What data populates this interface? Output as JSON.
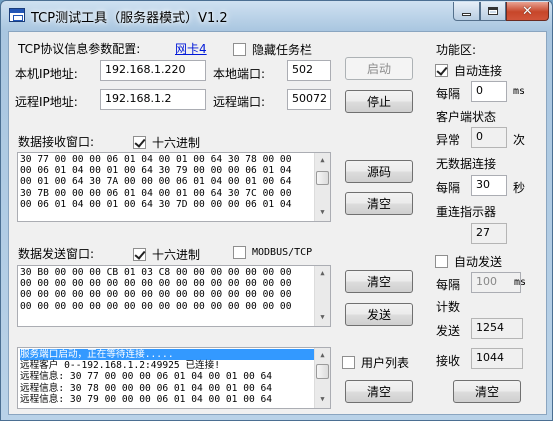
{
  "window": {
    "title": "TCP测试工具（服务器模式）V1.2"
  },
  "params": {
    "header": "TCP协议信息参数配置:",
    "nic_link": "网卡4",
    "hide_taskbar_label": "隐藏任务栏",
    "hide_taskbar_checked": false,
    "local_ip_label": "本机IP地址:",
    "local_ip": "192.168.1.220",
    "local_port_label": "本地端口:",
    "local_port": "502",
    "remote_ip_label": "远程IP地址:",
    "remote_ip": "192.168.1.2",
    "remote_port_label": "远程端口:",
    "remote_port": "50072",
    "start_label": "启动",
    "stop_label": "停止"
  },
  "receive": {
    "header": "数据接收窗口:",
    "hex_label": "十六进制",
    "hex_checked": true,
    "lines": [
      "30 77 00 00 00 06 01 04 00 01 00 64 30 78 00 00",
      "00 06 01 04 00 01 00 64 30 79 00 00 00 06 01 04",
      "00 01 00 64 30 7A 00 00 00 06 01 04 00 01 00 64",
      "30 7B 00 00 00 06 01 04 00 01 00 64 30 7C 00 00",
      "00 06 01 04 00 01 00 64 30 7D 00 00 00 06 01 04"
    ],
    "source_label": "源码",
    "clear_label": "清空"
  },
  "send": {
    "header": "数据发送窗口:",
    "hex_label": "十六进制",
    "hex_checked": true,
    "modbus_label": "MODBUS/TCP",
    "modbus_checked": false,
    "lines": [
      "30 B0 00 00 00 CB 01 03 C8 00 00 00 00 00 00 00",
      "00 00 00 00 00 00 00 00 00 00 00 00 00 00 00 00",
      "00 00 00 00 00 00 00 00 00 00 00 00 00 00 00 00",
      "00 00 00 00 00 00 00 00 00 00 00 00 00 00 00 00"
    ],
    "clear_label": "清空",
    "send_label": "发送"
  },
  "log": {
    "lines": [
      "服务端口启动，正在等待连接.....",
      "远程客户 0--192.168.1.2:49925 已连接!",
      "远程信息: 30 77 00 00 00 06 01 04 00 01 00 64",
      "远程信息: 30 78 00 00 00 06 01 04 00 01 00 64",
      "远程信息: 30 79 00 00 00 06 01 04 00 01 00 64"
    ],
    "user_list_label": "用户列表",
    "user_list_checked": false,
    "clear_label": "清空"
  },
  "functions": {
    "header": "功能区:",
    "auto_connect_label": "自动连接",
    "auto_connect_checked": true,
    "interval_label": "每隔",
    "interval_value": "0",
    "interval_unit": "ms",
    "client_status_label": "客户端状态",
    "abnormal_label": "异常",
    "abnormal_count": "0",
    "abnormal_unit": "次",
    "no_data_label": "无数据连接",
    "no_data_interval_label": "每隔",
    "no_data_interval": "30",
    "no_data_unit": "秒",
    "reconnect_label": "重连指示器",
    "reconnect_value": "27",
    "auto_send_label": "自动发送",
    "auto_send_checked": false,
    "send_interval_label": "每隔",
    "send_interval": "100",
    "send_interval_unit": "ms",
    "count_label": "计数",
    "sent_label": "发送",
    "sent_value": "1254",
    "received_label": "接收",
    "received_value": "1044",
    "clear_label": "清空"
  }
}
